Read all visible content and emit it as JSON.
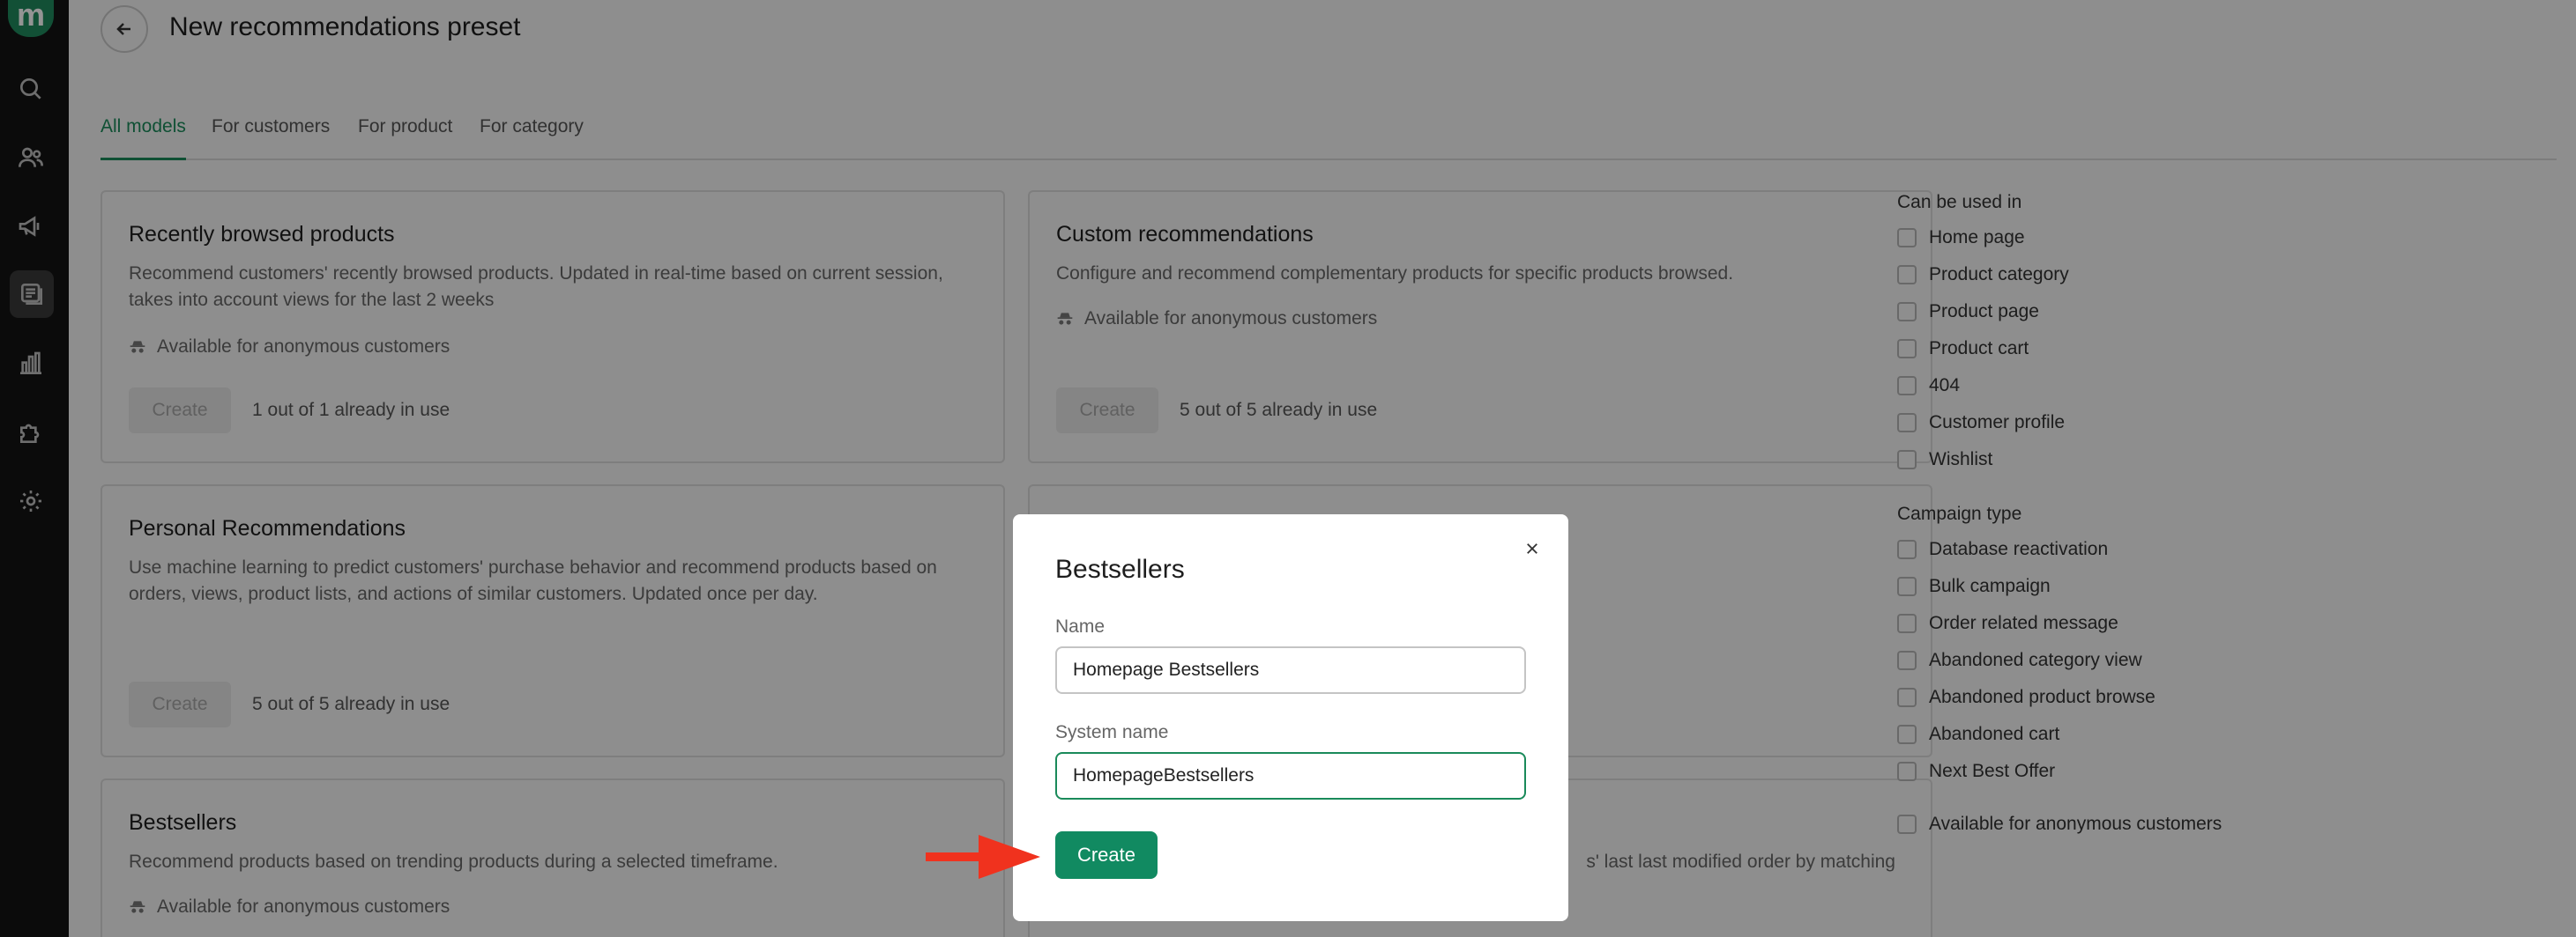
{
  "app": {
    "logo_letter": "m",
    "brand_color": "#1a8a5a"
  },
  "sidebar": {
    "icons": [
      "search-icon",
      "users-icon",
      "megaphone-icon",
      "recommendations-icon",
      "analytics-icon",
      "integrations-icon",
      "settings-icon"
    ],
    "active": "recommendations-icon"
  },
  "header": {
    "title": "New recommendations preset"
  },
  "tabs": [
    {
      "label": "All models",
      "active": true
    },
    {
      "label": "For customers",
      "active": false
    },
    {
      "label": "For product",
      "active": false
    },
    {
      "label": "For category",
      "active": false
    }
  ],
  "cards": [
    {
      "title": "Recently browsed products",
      "description": "Recommend customers' recently browsed products. Updated in real-time based on current session, takes into account views for the last 2 weeks",
      "anonymous": "Available for anonymous customers",
      "create_label": "Create",
      "usage": "1 out of 1 already in use"
    },
    {
      "title": "Custom recommendations",
      "description": "Configure and recommend complementary products for specific products browsed.",
      "anonymous": "Available for anonymous customers",
      "create_label": "Create",
      "usage": "5 out of 5 already in use"
    },
    {
      "title": "Personal Recommendations",
      "description": "Use machine learning to predict customers' purchase behavior and recommend products based on orders, views, product lists, and actions of similar customers. Updated once per day.",
      "create_label": "Create",
      "usage": "5 out of 5 already in use"
    },
    {
      "title": "Bestsellers",
      "description": "Recommend products based on trending products during a selected timeframe.",
      "anonymous": "Available for anonymous customers"
    },
    {
      "description_fragment": "s' last last modified order by matching"
    }
  ],
  "filters": {
    "can_be_used_in": {
      "title": "Can be used in",
      "items": [
        "Home page",
        "Product category",
        "Product page",
        "Product cart",
        "404",
        "Customer profile",
        "Wishlist"
      ]
    },
    "campaign_type": {
      "title": "Campaign type",
      "items": [
        "Database reactivation",
        "Bulk campaign",
        "Order related message",
        "Abandoned category view",
        "Abandoned product browse",
        "Abandoned cart",
        "Next Best Offer"
      ]
    },
    "anonymous_label": "Available for anonymous customers"
  },
  "modal": {
    "title": "Bestsellers",
    "name_label": "Name",
    "name_value": "Homepage Bestsellers",
    "system_name_label": "System name",
    "system_name_value": "HomepageBestsellers",
    "create_label": "Create"
  },
  "annotation": {
    "arrow_color": "#f0321e"
  }
}
